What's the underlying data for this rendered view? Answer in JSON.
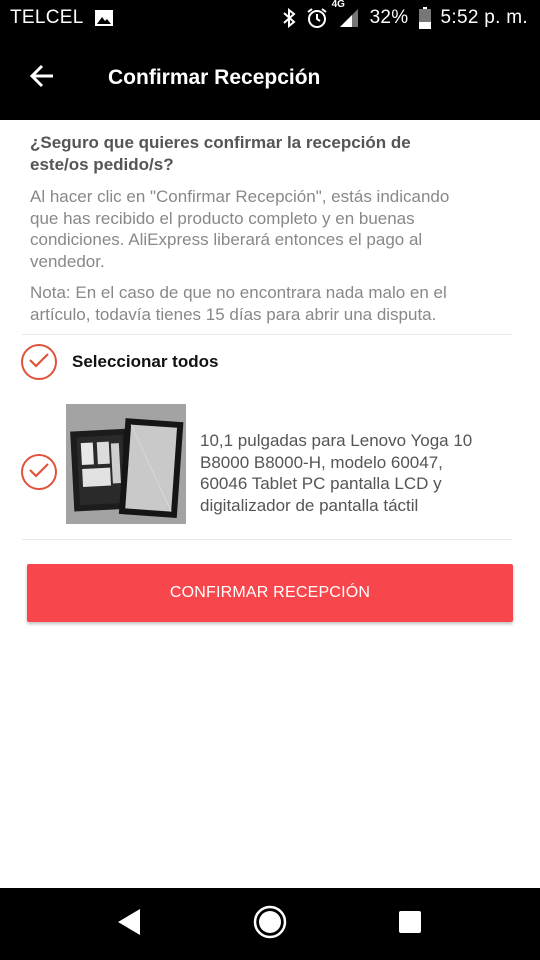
{
  "status_bar": {
    "carrier": "TELCEL",
    "network": "4G",
    "battery": "32%",
    "time": "5:52 p. m.",
    "icons": [
      "image-icon",
      "bluetooth-icon",
      "alarm-icon",
      "signal-icon",
      "battery-icon"
    ]
  },
  "app_bar": {
    "title": "Confirmar Recepción",
    "back_icon": "back-arrow-icon"
  },
  "content": {
    "question": "¿Seguro que quieres confirmar la recepción de este/os pedido/s?",
    "info": "Al hacer clic en \"Confirmar Recepción\", estás indicando que has recibido el producto completo y en buenas condiciones. AliExpress liberará entonces el pago al vendedor.",
    "note": "Nota: En el caso de que no encontrara nada malo en el artículo, todavía tienes 15 días para abrir una disputa.",
    "select_all": {
      "label": "Seleccionar todos",
      "checked": true
    },
    "products": [
      {
        "title": "10,1 pulgadas para Lenovo Yoga 10 B8000 B8000-H, modelo 60047, 60046 Tablet PC pantalla LCD y digitalizador de pantalla táctil",
        "checked": true
      }
    ],
    "confirm_button_label": "CONFIRMAR RECEPCIÓN"
  },
  "nav_bar": {
    "buttons": [
      "back-triangle-icon",
      "home-circle-icon",
      "recents-square-icon"
    ]
  },
  "colors": {
    "accent": "#e0533a",
    "button": "#f8474c",
    "bars": "#000000"
  }
}
